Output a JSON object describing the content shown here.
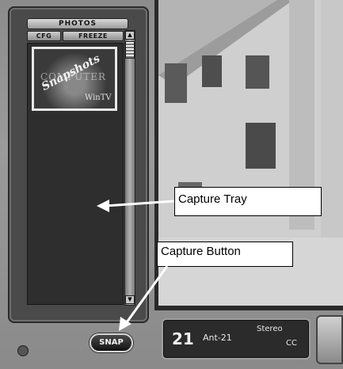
{
  "tray": {
    "header": "PHOTOS",
    "cfg_label": "CFG",
    "freeze_label": "FREEZE",
    "thumbnail": {
      "snapshots_text": "Snapshots",
      "computer_text": "COMPUTER",
      "wintv_text": "WinTV"
    },
    "snap_label": "SNAP"
  },
  "channel": {
    "number": "21",
    "name": "Ant-21",
    "audio": "Stereo",
    "cc": "CC"
  },
  "callouts": {
    "capture_tray": "Capture Tray",
    "capture_button": "Capture Button"
  },
  "icons": {
    "scroll_up": "triangle-up-icon",
    "scroll_down": "triangle-down-icon"
  },
  "colors": {
    "frame": "#8c8c8c",
    "tray": "#2e2e2e",
    "callout_bg": "#ffffff"
  }
}
